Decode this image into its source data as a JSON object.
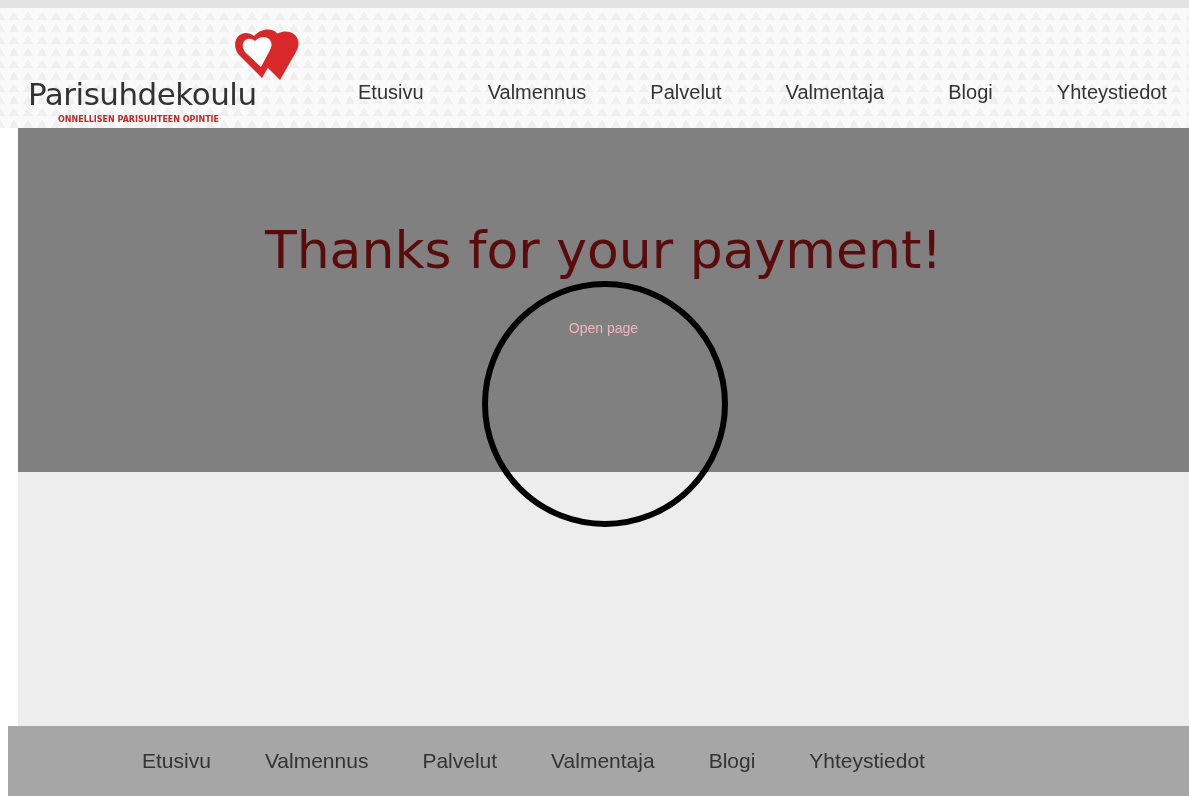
{
  "logo": {
    "name": "Parisuhdekoulu",
    "tagline": "ONNELLISEN PARISUHTEEN OPINTIE"
  },
  "nav": [
    {
      "label": "Etusivu"
    },
    {
      "label": "Valmennus"
    },
    {
      "label": "Palvelut"
    },
    {
      "label": "Valmentaja"
    },
    {
      "label": "Blogi"
    },
    {
      "label": "Yhteystiedot"
    }
  ],
  "hero": {
    "heading": "Thanks for your payment!",
    "link": "Open page"
  },
  "footer_nav": [
    {
      "label": "Etusivu"
    },
    {
      "label": "Valmennus"
    },
    {
      "label": "Palvelut"
    },
    {
      "label": "Valmentaja"
    },
    {
      "label": "Blogi"
    },
    {
      "label": "Yhteystiedot"
    }
  ]
}
